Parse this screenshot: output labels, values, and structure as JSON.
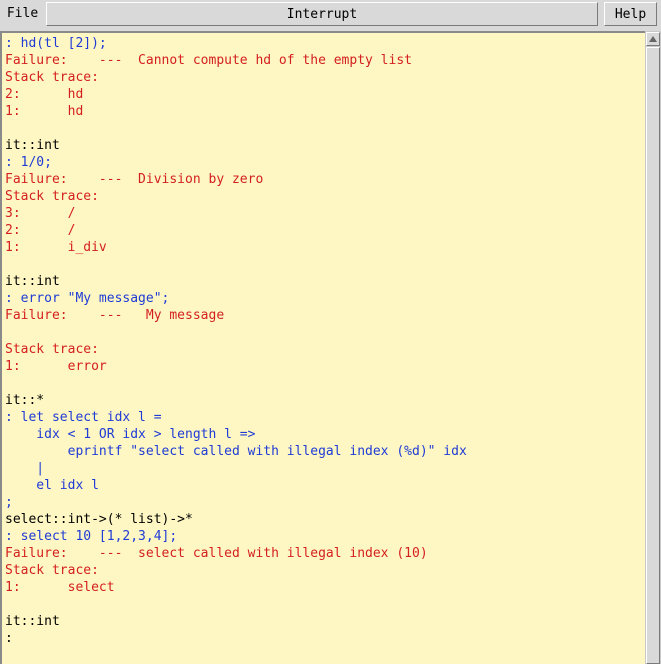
{
  "toolbar": {
    "file_label": "File",
    "interrupt_label": "Interrupt",
    "help_label": "Help"
  },
  "console": {
    "lines": [
      {
        "text": ": hd(tl [2]);",
        "kind": "input"
      },
      {
        "text": "Failure:    ---  Cannot compute hd of the empty list",
        "kind": "fail"
      },
      {
        "text": "Stack trace:",
        "kind": "fail"
      },
      {
        "text": "2:      hd",
        "kind": "fail"
      },
      {
        "text": "1:      hd",
        "kind": "fail"
      },
      {
        "text": "",
        "kind": "out"
      },
      {
        "text": "it::int",
        "kind": "out"
      },
      {
        "text": ": 1/0;",
        "kind": "input"
      },
      {
        "text": "Failure:    ---  Division by zero",
        "kind": "fail"
      },
      {
        "text": "Stack trace:",
        "kind": "fail"
      },
      {
        "text": "3:      /",
        "kind": "fail"
      },
      {
        "text": "2:      /",
        "kind": "fail"
      },
      {
        "text": "1:      i_div",
        "kind": "fail"
      },
      {
        "text": "",
        "kind": "out"
      },
      {
        "text": "it::int",
        "kind": "out"
      },
      {
        "text": ": error \"My message\";",
        "kind": "input"
      },
      {
        "text": "Failure:    ---   My message",
        "kind": "fail"
      },
      {
        "text": "",
        "kind": "out"
      },
      {
        "text": "Stack trace:",
        "kind": "fail"
      },
      {
        "text": "1:      error",
        "kind": "fail"
      },
      {
        "text": "",
        "kind": "out"
      },
      {
        "text": "it::*",
        "kind": "out"
      },
      {
        "text": ": let select idx l =",
        "kind": "input"
      },
      {
        "text": "    idx < 1 OR idx > length l =>",
        "kind": "input"
      },
      {
        "text": "        eprintf \"select called with illegal index (%d)\" idx",
        "kind": "input"
      },
      {
        "text": "    |",
        "kind": "input"
      },
      {
        "text": "    el idx l",
        "kind": "input"
      },
      {
        "text": ";",
        "kind": "input"
      },
      {
        "text": "select::int->(* list)->*",
        "kind": "out"
      },
      {
        "text": ": select 10 [1,2,3,4];",
        "kind": "input"
      },
      {
        "text": "Failure:    ---  select called with illegal index (10)",
        "kind": "fail"
      },
      {
        "text": "Stack trace:",
        "kind": "fail"
      },
      {
        "text": "1:      select",
        "kind": "fail"
      },
      {
        "text": "",
        "kind": "out"
      },
      {
        "text": "it::int",
        "kind": "out"
      },
      {
        "text": ":",
        "kind": "out"
      }
    ]
  },
  "colors": {
    "console_background": "#fef7c3",
    "input_text": "#1f3bd6",
    "failure_text": "#d41f1f",
    "output_text": "#000000"
  }
}
